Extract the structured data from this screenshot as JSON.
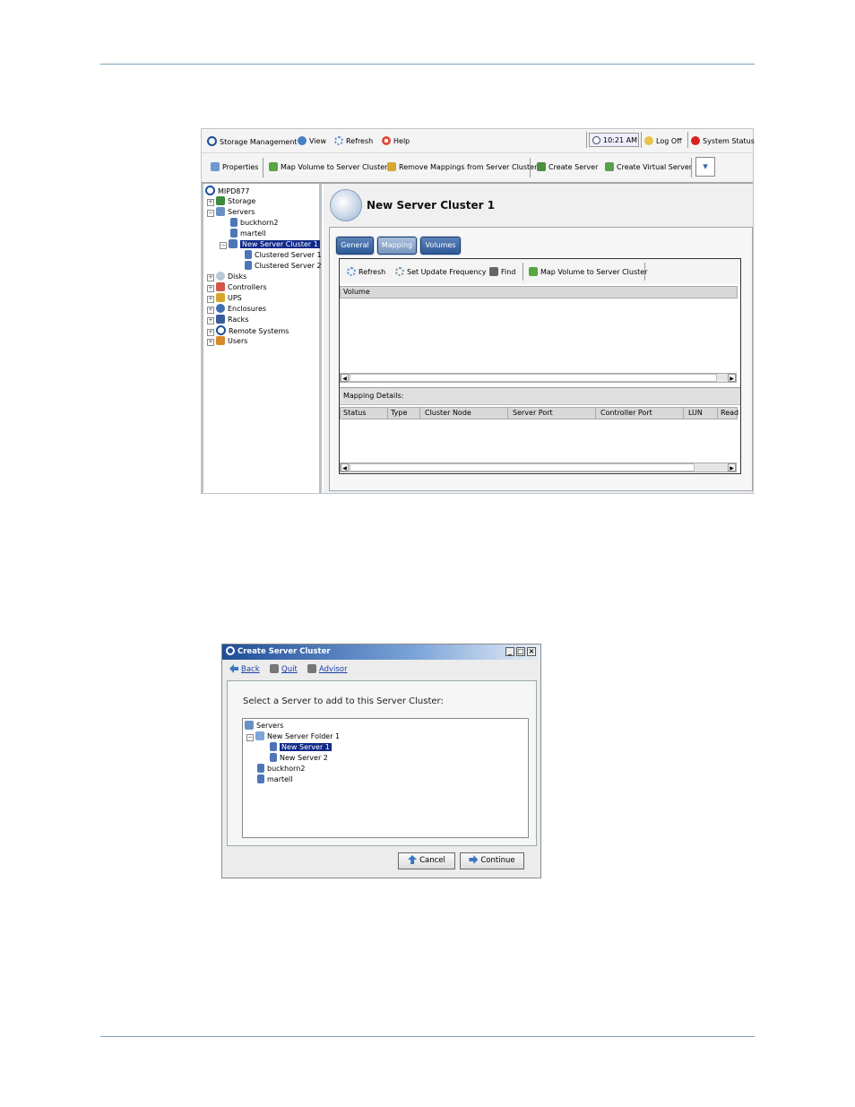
{
  "window1": {
    "menu": {
      "storage_management": "Storage Management",
      "view": "View",
      "refresh": "Refresh",
      "help": "Help",
      "clock": "10:21 AM",
      "log_off": "Log Off",
      "system_status": "System Status"
    },
    "toolbar": {
      "properties": "Properties",
      "map_volume": "Map Volume to Server Cluster",
      "remove_mappings": "Remove Mappings from Server Cluster",
      "create_server": "Create Server",
      "create_virtual_server": "Create Virtual Server"
    },
    "tree": {
      "root": "MIPD877",
      "storage": "Storage",
      "servers": "Servers",
      "buckhorn2": "buckhorn2",
      "martell": "martell",
      "cluster": "New Server Cluster 1",
      "cs1": "Clustered Server 1",
      "cs2": "Clustered Server 2",
      "disks": "Disks",
      "controllers": "Controllers",
      "ups": "UPS",
      "enclosures": "Enclosures",
      "racks": "Racks",
      "remote_systems": "Remote Systems",
      "users": "Users"
    },
    "title": "New Server Cluster 1",
    "tabs": {
      "general": "General",
      "mapping": "Mapping",
      "volumes": "Volumes"
    },
    "inner_toolbar": {
      "refresh": "Refresh",
      "set_update_frequency": "Set Update Frequency",
      "find": "Find",
      "map_volume": "Map Volume to Server Cluster"
    },
    "volume_header": "Volume",
    "mapping_details": "Mapping Details:",
    "columns": {
      "status": "Status",
      "type": "Type",
      "cluster_node": "Cluster Node",
      "server_port": "Server Port",
      "controller_port": "Controller Port",
      "lun": "LUN",
      "read": "Read"
    }
  },
  "dialog": {
    "title": "Create Server Cluster",
    "back": "Back",
    "quit": "Quit",
    "advisor": "Advisor",
    "prompt": "Select a Server to add to this Server Cluster:",
    "tree": {
      "servers": "Servers",
      "folder": "New Server Folder 1",
      "ns1": "New Server 1",
      "ns2": "New Server 2",
      "buckhorn2": "buckhorn2",
      "martell": "martell"
    },
    "cancel": "Cancel",
    "continue": "Continue"
  },
  "colors": {
    "accent": "#2d5a98",
    "selection": "#102a8a",
    "rule": "#7ea3b7"
  }
}
